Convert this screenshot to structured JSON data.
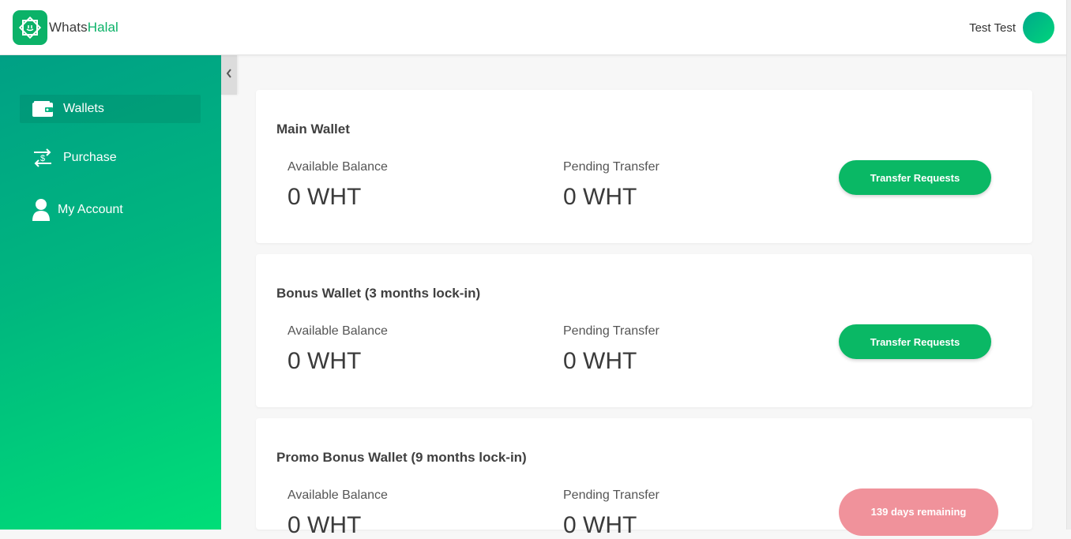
{
  "brand": {
    "name_part1": "Whats",
    "name_part2": "Halal",
    "logo_color": "#0bb268"
  },
  "header": {
    "user_name": "Test Test"
  },
  "sidebar": {
    "items": [
      {
        "label": "Wallets",
        "icon": "wallet-icon",
        "active": true
      },
      {
        "label": "Purchase",
        "icon": "currency-exchange-icon",
        "active": false
      },
      {
        "label": "My Account",
        "icon": "user-icon",
        "active": false
      }
    ]
  },
  "wallets": [
    {
      "title": "Main Wallet",
      "available_label": "Available Balance",
      "available_value": "0 WHT",
      "pending_label": "Pending Transfer",
      "pending_value": "0 WHT",
      "action_label": "Transfer Requests"
    },
    {
      "title": "Bonus Wallet (3 months lock-in)",
      "available_label": "Available Balance",
      "available_value": "0 WHT",
      "pending_label": "Pending Transfer",
      "pending_value": "0 WHT",
      "action_label": "Transfer Requests"
    },
    {
      "title": "Promo Bonus Wallet (9 months lock-in)",
      "available_label": "Available Balance",
      "available_value": "0 WHT",
      "pending_label": "Pending Transfer",
      "pending_value": "0 WHT",
      "status_label": "139 days remaining"
    }
  ],
  "colors": {
    "accent": "#0ab865",
    "sidebar_start": "#00a085",
    "sidebar_end": "#00de78",
    "lock_badge": "#f0929b"
  }
}
